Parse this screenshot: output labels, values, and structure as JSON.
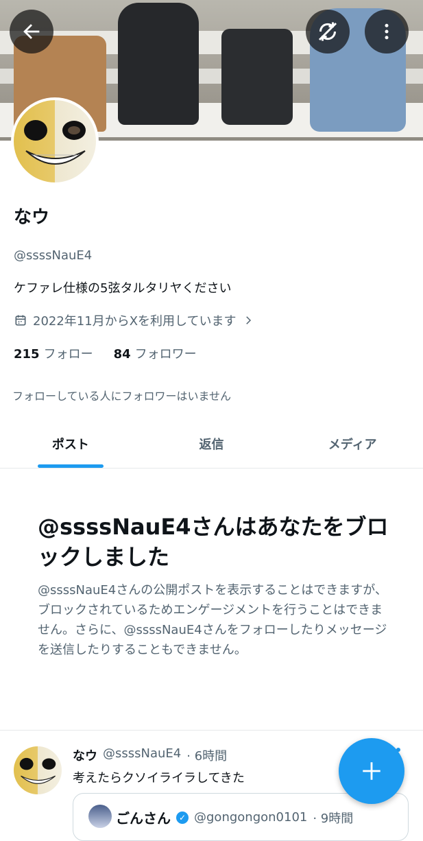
{
  "profile": {
    "name": "なウ",
    "handle": "@ssssNauE4",
    "bio": "ケファレ仕様の5弦タルタリヤください",
    "joined": "2022年11月からXを利用しています",
    "following_count": "215",
    "following_label": "フォロー",
    "followers_count": "84",
    "followers_label": "フォロワー",
    "mutual_note": "フォローしている人にフォロワーはいません"
  },
  "tabs": [
    {
      "label": "ポスト",
      "active": true
    },
    {
      "label": "返信",
      "active": false
    },
    {
      "label": "メディア",
      "active": false
    }
  ],
  "blocked": {
    "title": "@ssssNauE4さんはあなたをブロックしました",
    "description": "@ssssNauE4さんの公開ポストを表示することはできますが、ブロックされているためエンゲージメントを行うことはできません。さらに、@ssssNauE4さんをフォローしたりメッセージを送信したりすることもできません。"
  },
  "post": {
    "author_name": "なウ",
    "author_handle": "@ssssNauE4",
    "time": "· 6時間",
    "text": "考えたらクソイライラしてきた",
    "quote": {
      "author_name": "ごんさん",
      "author_handle": "@gongongon0101",
      "time": "· 9時間"
    }
  },
  "icons": {
    "back": "arrow-left-icon",
    "sync": "sync-off-icon",
    "more": "more-vertical-icon",
    "calendar": "calendar-icon",
    "chevron": "chevron-right-icon",
    "compose": "plus-icon",
    "verified": "verified-badge-icon"
  },
  "colors": {
    "accent": "#1d9bf0",
    "text": "#0f1419",
    "secondary": "#536471"
  }
}
